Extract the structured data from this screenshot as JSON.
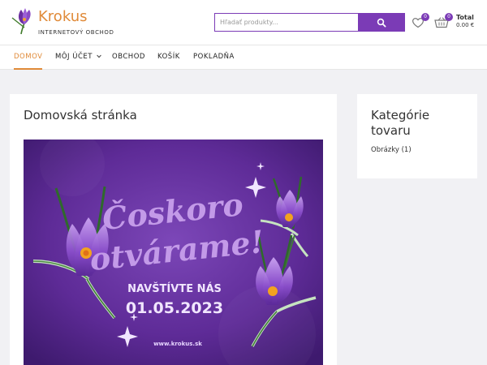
{
  "brand": {
    "name": "Krokus",
    "tagline": "INTERNETOVÝ OBCHOD"
  },
  "search": {
    "placeholder": "Hľadať produkty...",
    "value": ""
  },
  "header": {
    "wishlist_count": "0",
    "cart_count": "0",
    "cart_total_label": "Total",
    "cart_total_value": "0.00 €"
  },
  "nav": {
    "home": "DOMOV",
    "account": "MÔJ ÚČET",
    "shop": "OBCHOD",
    "cart": "KOŠÍK",
    "checkout": "POKLADŇA"
  },
  "main": {
    "title": "Domovská stránka",
    "banner": {
      "headline_line1": "Čoskoro",
      "headline_line2": "otvárame!",
      "visit_label": "NAVŠTÍVTE NÁS",
      "date": "01.05.2023",
      "website": "www.krokus.sk"
    }
  },
  "sidebar": {
    "title_line1": "Kategórie",
    "title_line2": "tovaru",
    "category": "Obrázky (1)"
  },
  "colors": {
    "accent": "#e08a38",
    "brand_purple": "#7b3bb6",
    "page_background": "#f1f1f4"
  }
}
